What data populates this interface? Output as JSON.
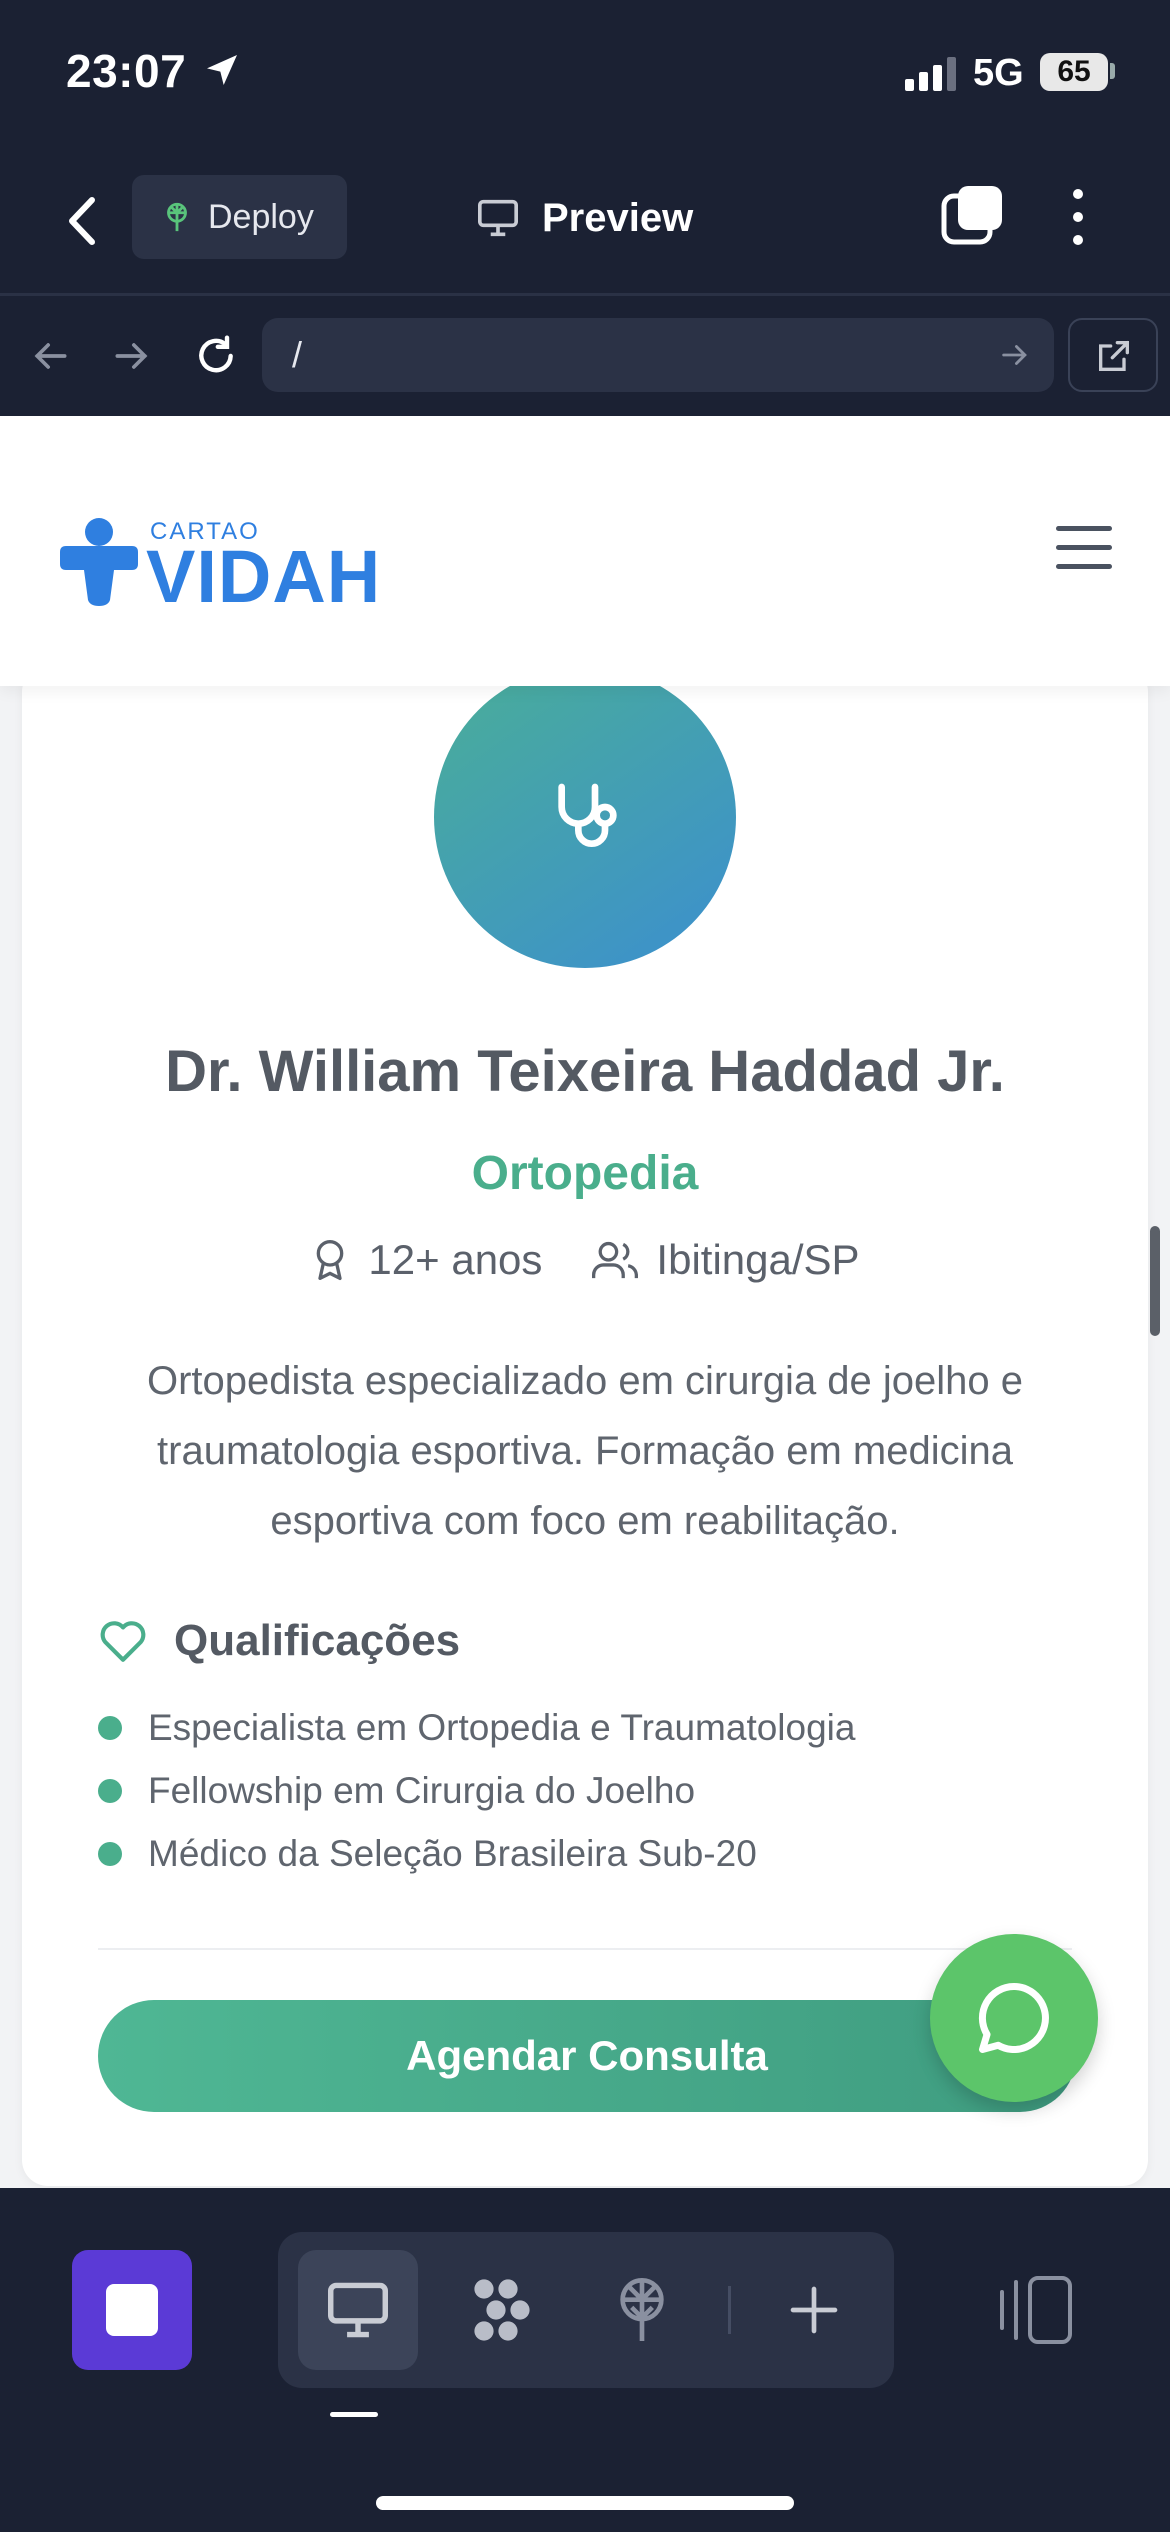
{
  "status_bar": {
    "time": "23:07",
    "network": "5G",
    "battery": "65"
  },
  "app_bar": {
    "deploy_label": "Deploy",
    "preview_label": "Preview"
  },
  "browser": {
    "url": "/"
  },
  "site": {
    "logo_small": "CARTAO",
    "logo_big": "VIDAH",
    "colors": {
      "brand_blue": "#2f7fe0",
      "accent_green": "#4aae8c",
      "whatsapp": "#5cc56a"
    }
  },
  "doctor": {
    "name": "Dr. William Teixeira Haddad Jr.",
    "specialty": "Ortopedia",
    "experience": "12+ anos",
    "location": "Ibitinga/SP",
    "description": "Ortopedista especializado em cirurgia de joelho e traumatologia esportiva. Formação em medicina esportiva com foco em reabilitação.",
    "qualifications_title": "Qualificações",
    "qualifications": [
      "Especialista em Ortopedia e Traumatologia",
      "Fellowship em Cirurgia do Joelho",
      "Médico da Seleção Brasileira Sub-20"
    ],
    "cta_label": "Agendar Consulta"
  },
  "icons": {
    "avatar": "stethoscope-icon",
    "experience": "award-icon",
    "location": "users-icon",
    "qualifications": "heart-icon",
    "floating": "whatsapp-chat-icon"
  }
}
